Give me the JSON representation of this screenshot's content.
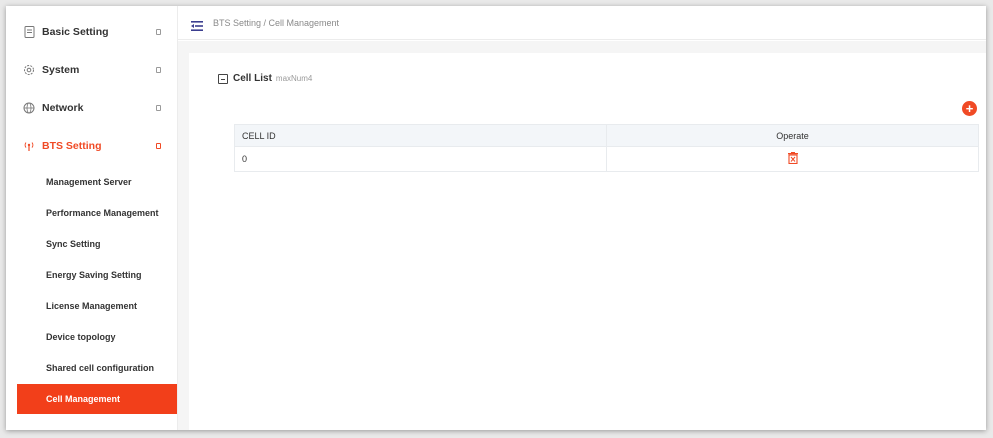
{
  "sidebar": {
    "menu": [
      {
        "label": "Basic Setting",
        "icon": "document-icon",
        "active": false
      },
      {
        "label": "System",
        "icon": "gear-icon",
        "active": false
      },
      {
        "label": "Network",
        "icon": "globe-icon",
        "active": false
      },
      {
        "label": "BTS Setting",
        "icon": "antenna-icon",
        "active": true
      }
    ],
    "submenu": [
      {
        "label": "Management Server"
      },
      {
        "label": "Performance Management"
      },
      {
        "label": "Sync Setting"
      },
      {
        "label": "Energy Saving Setting"
      },
      {
        "label": "License Management"
      },
      {
        "label": "Device topology"
      },
      {
        "label": "Shared cell configuration"
      },
      {
        "label": "Cell Management",
        "active": true
      }
    ]
  },
  "header": {
    "breadcrumb": "BTS Setting / Cell Management"
  },
  "cell_list": {
    "title": "Cell List",
    "max_label": "maxNum4",
    "columns": [
      "CELL ID",
      "Operate"
    ],
    "rows": [
      {
        "cell_id": "0"
      }
    ]
  },
  "colors": {
    "accent": "#f04a25",
    "active_bg": "#f23f1a",
    "text": "#333333"
  }
}
